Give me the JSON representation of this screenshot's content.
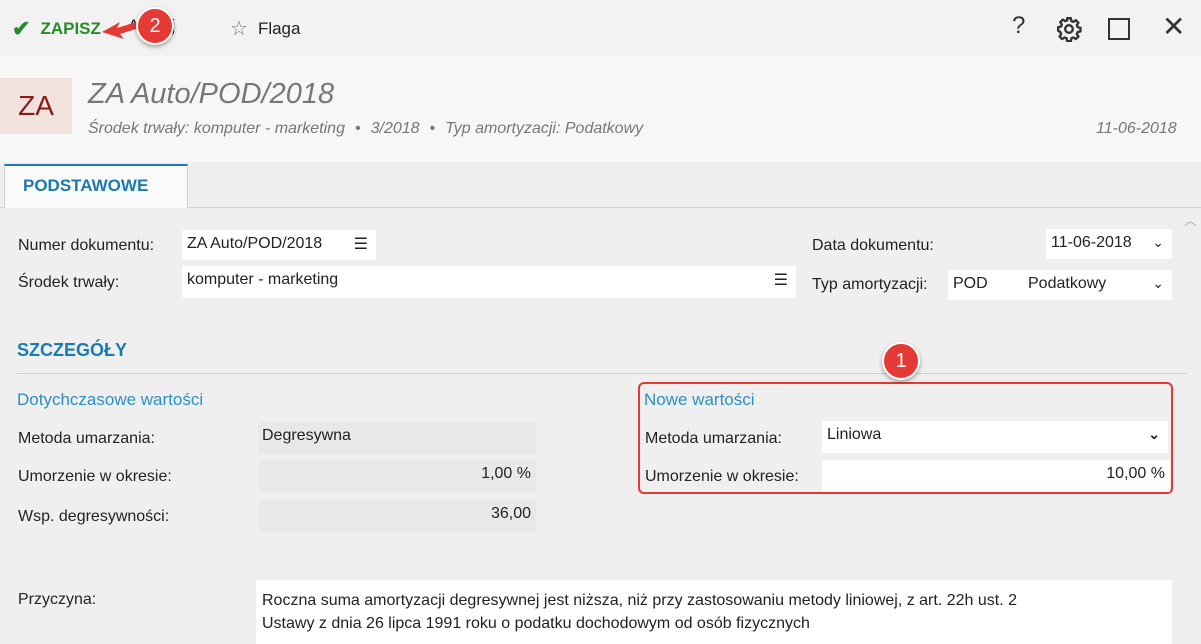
{
  "toolbar": {
    "save_label": "ZAPISZ",
    "cancel_label": "Anuluj",
    "flag_label": "Flaga",
    "help_label": "?"
  },
  "callouts": {
    "one": "1",
    "two": "2"
  },
  "header": {
    "avatar": "ZA",
    "title": "ZA Auto/POD/2018",
    "subtitle_asset": "Środek trwały: komputer - marketing",
    "subtitle_period": "3/2018",
    "subtitle_type": "Typ amortyzacji: Podatkowy",
    "date": "11-06-2018"
  },
  "tabs": [
    {
      "label": "PODSTAWOWE"
    }
  ],
  "form": {
    "doc_number_label": "Numer dokumentu:",
    "doc_number_value": "ZA Auto/POD/2018",
    "asset_label": "Środek trwały:",
    "asset_value": "komputer - marketing",
    "doc_date_label": "Data dokumentu:",
    "doc_date_value": "11-06-2018",
    "amort_type_label": "Typ amortyzacji:",
    "amort_type_code": "POD",
    "amort_type_name": "Podatkowy"
  },
  "details": {
    "section_title": "SZCZEGÓŁY",
    "old_title": "Dotychczasowe wartości",
    "new_title": "Nowe wartości",
    "method_label": "Metoda umarzania:",
    "rate_label": "Umorzenie w okresie:",
    "degr_label": "Wsp. degresywności:",
    "old_method": "Degresywna",
    "old_rate": "1,00 %",
    "old_degr": "36,00",
    "new_method": "Liniowa",
    "new_rate": "10,00 %",
    "reason_label": "Przyczyna:",
    "reason_line1": "Roczna suma amortyzacji degresywnej jest niższa, niż przy zastosowaniu metody liniowej, z art. 22h ust. 2",
    "reason_line2": "Ustawy z dnia 26 lipca 1991 roku o podatku dochodowym od osób fizycznych"
  },
  "icons": {
    "save": "check-icon",
    "flag": "star-icon",
    "help": "help-icon",
    "settings": "gear-icon",
    "maximize": "maximize-icon",
    "close": "close-icon"
  },
  "colors": {
    "accent": "#1b7ab1",
    "save_green": "#2a8a2a",
    "callout_red": "#e53935"
  }
}
